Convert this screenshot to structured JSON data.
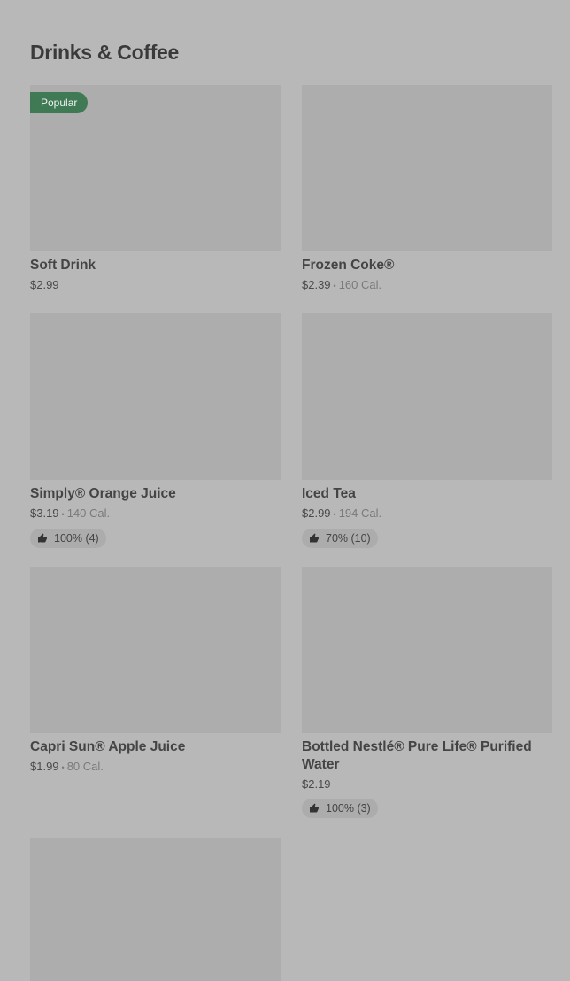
{
  "section": {
    "title": "Drinks & Coffee"
  },
  "items": [
    {
      "name": "Soft Drink",
      "price": "$2.99",
      "calories": "",
      "badge": "Popular",
      "rating": ""
    },
    {
      "name": "Frozen Coke®",
      "price": "$2.39",
      "calories": "160 Cal.",
      "badge": "",
      "rating": ""
    },
    {
      "name": "Simply® Orange Juice",
      "price": "$3.19",
      "calories": "140 Cal.",
      "badge": "",
      "rating": "100% (4)"
    },
    {
      "name": "Iced Tea",
      "price": "$2.99",
      "calories": "194 Cal.",
      "badge": "",
      "rating": "70% (10)"
    },
    {
      "name": "Capri Sun® Apple Juice",
      "price": "$1.99",
      "calories": "80 Cal.",
      "badge": "",
      "rating": ""
    },
    {
      "name": "Bottled Nestlé® Pure Life® Purified Water",
      "price": "$2.19",
      "calories": "",
      "badge": "",
      "rating": "100% (3)"
    }
  ],
  "icons": {
    "rating": "thumbs-up-icon"
  },
  "colors": {
    "background": "#b8b8b8",
    "image_placeholder": "#adadad",
    "popular_badge": "#3f7a55"
  }
}
